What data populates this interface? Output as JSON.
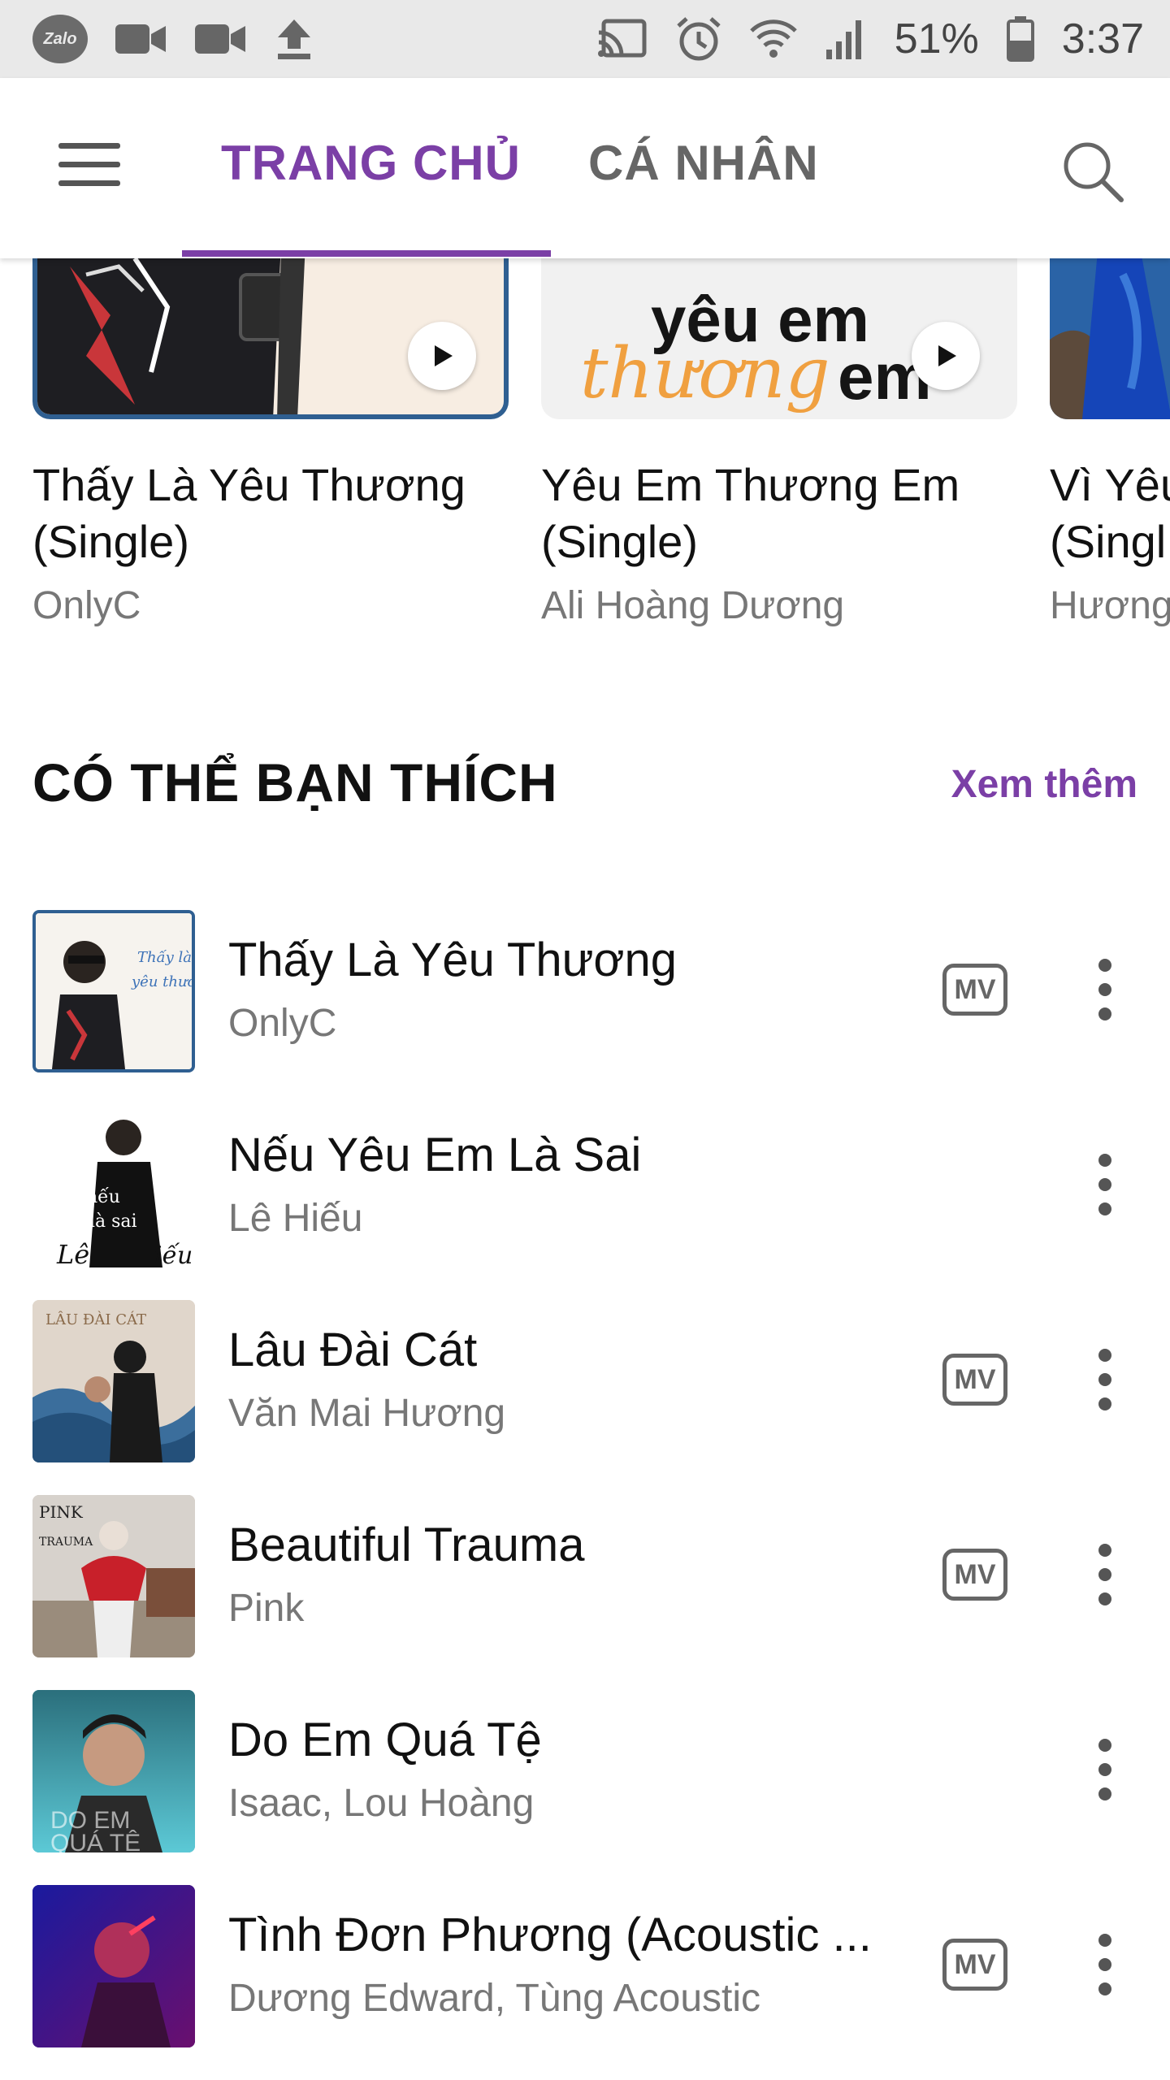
{
  "status_bar": {
    "app_badge": "Zalo",
    "battery": "51%",
    "time": "3:37"
  },
  "app_bar": {
    "tabs": [
      {
        "label": "TRANG CHỦ",
        "active": true
      },
      {
        "label": "CÁ NHÂN",
        "active": false
      }
    ]
  },
  "albums": [
    {
      "title_line1": "Thấy Là Yêu Thương",
      "title_line2": "(Single)",
      "artist": "OnlyC"
    },
    {
      "title_line1": "Yêu Em Thương Em",
      "title_line2": "(Single)",
      "artist": "Ali Hoàng Dương",
      "cover_text_top": "yêu em",
      "cover_text_script": "thương",
      "cover_text_tail": "em"
    },
    {
      "title_line1": "Vì Yêu",
      "title_line2": "(Singl",
      "artist": "Hương"
    }
  ],
  "section": {
    "title": "CÓ THỂ BẠN THÍCH",
    "see_more": "Xem thêm"
  },
  "songs": [
    {
      "title": "Thấy Là Yêu Thương",
      "artist": "OnlyC",
      "has_mv": true
    },
    {
      "title": "Nếu Yêu Em Là Sai",
      "artist": "Lê Hiếu",
      "has_mv": false
    },
    {
      "title": "Lâu Đài Cát",
      "artist": "Văn Mai Hương",
      "has_mv": true
    },
    {
      "title": "Beautiful Trauma",
      "artist": "Pink",
      "has_mv": true
    },
    {
      "title": "Do Em Quá Tệ",
      "artist": "Isaac, Lou Hoàng",
      "has_mv": false
    },
    {
      "title": "Tình Đơn Phương (Acoustic ...",
      "artist": "Dương Edward, Tùng Acoustic",
      "has_mv": true
    }
  ],
  "mv_label": "MV",
  "colors": {
    "accent": "#7b3fa6",
    "status_bar_bg": "#e9e9e9",
    "secondary_text": "#777777"
  }
}
